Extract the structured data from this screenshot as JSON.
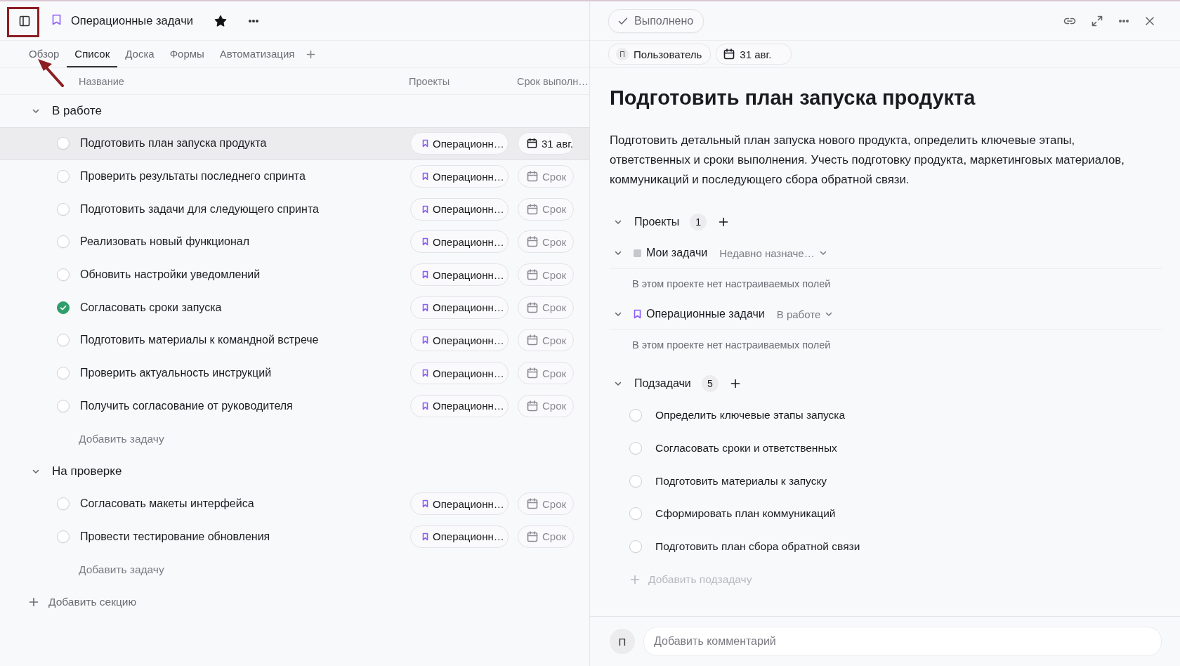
{
  "toolbar": {
    "title": "Операционные задачи",
    "starred": true
  },
  "tabs": [
    {
      "label": "Обзор",
      "selected": false
    },
    {
      "label": "Список",
      "selected": true
    },
    {
      "label": "Доска",
      "selected": false
    },
    {
      "label": "Формы",
      "selected": false
    },
    {
      "label": "Автоматизация",
      "selected": false
    }
  ],
  "columns": [
    "Название",
    "Проекты",
    "Срок выполн…"
  ],
  "sections": [
    {
      "title": "В работе",
      "expanded": true,
      "add_task": "Добавить задачу",
      "tasks": [
        {
          "name": "Подготовить план запуска продукта",
          "completed": false,
          "selected": true,
          "project": "Операционн…",
          "due": "31 авг.",
          "due_set": true
        },
        {
          "name": "Проверить результаты последнего спринта",
          "completed": false,
          "selected": false,
          "project": "Операционн…",
          "due": "Срок",
          "due_set": false
        },
        {
          "name": "Подготовить задачи для следующего спринта",
          "completed": false,
          "selected": false,
          "project": "Операционн…",
          "due": "Срок",
          "due_set": false
        },
        {
          "name": "Реализовать новый функционал",
          "completed": false,
          "selected": false,
          "project": "Операционн…",
          "due": "Срок",
          "due_set": false
        },
        {
          "name": "Обновить настройки уведомлений",
          "completed": false,
          "selected": false,
          "project": "Операционн…",
          "due": "Срок",
          "due_set": false
        },
        {
          "name": "Согласовать сроки запуска",
          "completed": true,
          "selected": false,
          "project": "Операционн…",
          "due": "Срок",
          "due_set": false
        },
        {
          "name": "Подготовить материалы к командной встрече",
          "completed": false,
          "selected": false,
          "project": "Операционн…",
          "due": "Срок",
          "due_set": false
        },
        {
          "name": "Проверить актуальность инструкций",
          "completed": false,
          "selected": false,
          "project": "Операционн…",
          "due": "Срок",
          "due_set": false
        },
        {
          "name": "Получить согласование от руководителя",
          "completed": false,
          "selected": false,
          "project": "Операционн…",
          "due": "Срок",
          "due_set": false
        }
      ]
    },
    {
      "title": "На проверке",
      "expanded": true,
      "add_task": "Добавить задачу",
      "tasks": [
        {
          "name": "Согласовать макеты интерфейса",
          "completed": false,
          "selected": false,
          "project": "Операционн…",
          "due": "Срок",
          "due_set": false
        },
        {
          "name": "Провести тестирование обновления",
          "completed": false,
          "selected": false,
          "project": "Операционн…",
          "due": "Срок",
          "due_set": false
        }
      ]
    }
  ],
  "add_section": "Добавить секцию",
  "detail": {
    "status": "Выполнено",
    "completed": false,
    "assignee_initial": "П",
    "assignee": "Пользователь",
    "due": "31 авг.",
    "title": "Подготовить план запуска продукта",
    "description": "Подготовить детальный план запуска нового продукта, определить ключевые этапы, ответственных и сроки выполнения. Учесть подготовку продукта, маркетинговых материалов, коммуникаций и последующего сбора обратной связи.",
    "projects": {
      "label": "Проекты",
      "count": "1",
      "expanded": true,
      "items": [
        {
          "name": "Мои задачи",
          "kind": "square",
          "status": "Недавно назначе…",
          "note": "В этом проекте нет настраиваемых полей",
          "expanded": true
        },
        {
          "name": "Операционные задачи",
          "kind": "bookmark",
          "status": "В работе",
          "note": "В этом проекте нет настраиваемых полей",
          "expanded": true
        }
      ]
    },
    "subtasks": {
      "label": "Подзадачи",
      "count": "5",
      "expanded": true,
      "add": "Добавить подзадачу",
      "items": [
        {
          "name": "Определить ключевые этапы запуска",
          "completed": false
        },
        {
          "name": "Согласовать сроки и ответственных",
          "completed": false
        },
        {
          "name": "Подготовить материалы к запуску",
          "completed": false
        },
        {
          "name": "Сформировать план коммуникаций",
          "completed": false
        },
        {
          "name": "Подготовить план сбора обратной связи",
          "completed": false
        }
      ]
    },
    "comment": {
      "avatar": "П",
      "placeholder": "Добавить комментарий"
    }
  }
}
